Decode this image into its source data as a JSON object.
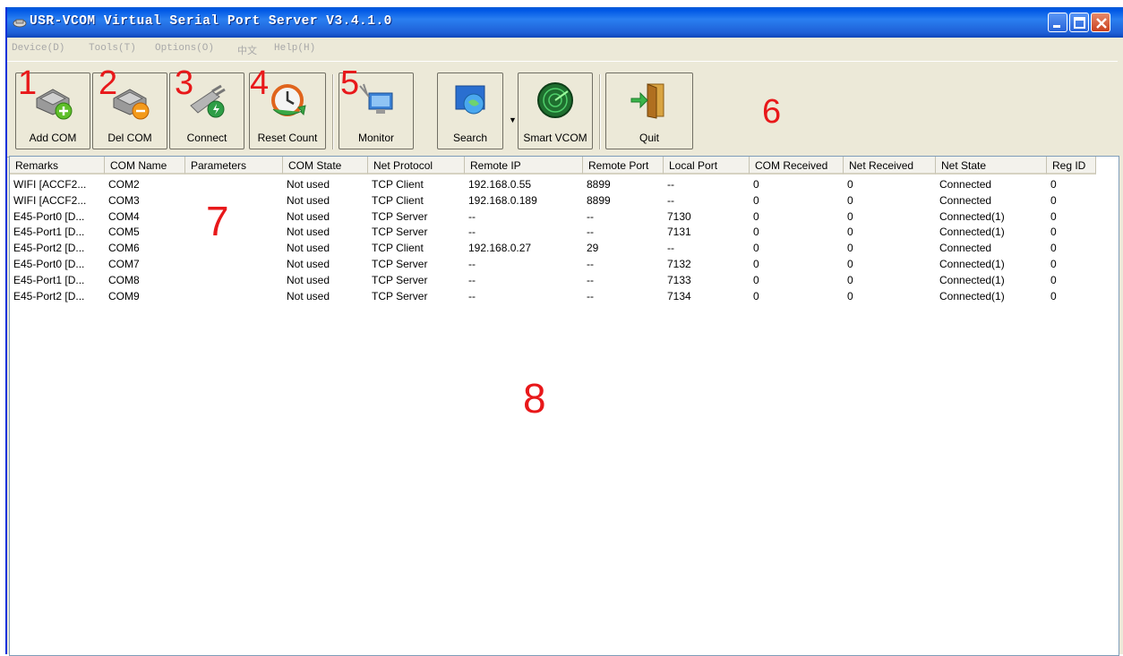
{
  "app": {
    "title": "USR-VCOM Virtual Serial Port Server V3.4.1.0"
  },
  "menu": [
    "Device(D)",
    "Tools(T)",
    "Options(O)",
    "中文",
    "Help(H)"
  ],
  "toolbar": {
    "buttons": [
      "Add COM",
      "Del COM",
      "Connect",
      "Reset Count",
      "Monitor",
      "Search",
      "Smart VCOM",
      "Quit"
    ]
  },
  "annotations": [
    "1",
    "2",
    "3",
    "4",
    "5",
    "6",
    "7",
    "8"
  ],
  "table": {
    "columns": [
      "Remarks",
      "COM Name",
      "Parameters",
      "COM State",
      "Net Protocol",
      "Remote IP",
      "Remote Port",
      "Local Port",
      "COM Received",
      "Net Received",
      "Net State",
      "Reg ID"
    ],
    "rows": [
      [
        "WIFI [ACCF2...",
        "COM2",
        "",
        "Not used",
        "TCP Client",
        "192.168.0.55",
        "8899",
        "--",
        "0",
        "0",
        "Connected",
        "0"
      ],
      [
        "WIFI [ACCF2...",
        "COM3",
        "",
        "Not used",
        "TCP Client",
        "192.168.0.189",
        "8899",
        "--",
        "0",
        "0",
        "Connected",
        "0"
      ],
      [
        "E45-Port0 [D...",
        "COM4",
        "",
        "Not used",
        "TCP Server",
        "--",
        "--",
        "7130",
        "0",
        "0",
        "Connected(1)",
        "0"
      ],
      [
        "E45-Port1 [D...",
        "COM5",
        "",
        "Not used",
        "TCP Server",
        "--",
        "--",
        "7131",
        "0",
        "0",
        "Connected(1)",
        "0"
      ],
      [
        "E45-Port2 [D...",
        "COM6",
        "",
        "Not used",
        "TCP Client",
        "192.168.0.27",
        "29",
        "--",
        "0",
        "0",
        "Connected",
        "0"
      ],
      [
        "E45-Port0 [D...",
        "COM7",
        "",
        "Not used",
        "TCP Server",
        "--",
        "--",
        "7132",
        "0",
        "0",
        "Connected(1)",
        "0"
      ],
      [
        "E45-Port1 [D...",
        "COM8",
        "",
        "Not used",
        "TCP Server",
        "--",
        "--",
        "7133",
        "0",
        "0",
        "Connected(1)",
        "0"
      ],
      [
        "E45-Port2 [D...",
        "COM9",
        "",
        "Not used",
        "TCP Server",
        "--",
        "--",
        "7134",
        "0",
        "0",
        "Connected(1)",
        "0"
      ]
    ]
  },
  "colors": {
    "titlebar": "#0058e6",
    "annotation": "#e8181a",
    "window_bg": "#ece9d8"
  }
}
